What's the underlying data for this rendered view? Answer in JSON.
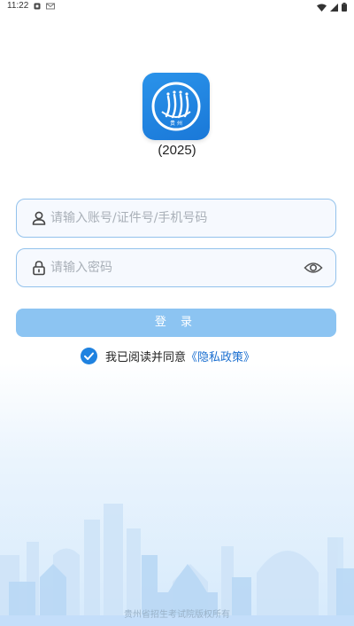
{
  "status_bar": {
    "time": "11:22",
    "left_icons": [
      "notification-icon",
      "mail-icon"
    ],
    "right_icons": [
      "wifi-icon",
      "signal-icon",
      "battery-icon"
    ]
  },
  "app": {
    "logo_icon": "exam-authority-logo",
    "logo_text": "贵 州",
    "year_label": "(2025)"
  },
  "login_form": {
    "account_placeholder": "请输入账号/证件号/手机号码",
    "account_value": "",
    "password_placeholder": "请输入密码",
    "password_value": "",
    "login_button_label": "登 录"
  },
  "agreement": {
    "checked": true,
    "text": "我已阅读并同意",
    "policy_link": "《隐私政策》"
  },
  "footer": {
    "copyright": "贵州省招生考试院版权所有"
  },
  "colors": {
    "accent": "#1f82e0",
    "button": "#8cc4f2",
    "field_border": "#93c2ec",
    "link": "#1b6fd0"
  }
}
